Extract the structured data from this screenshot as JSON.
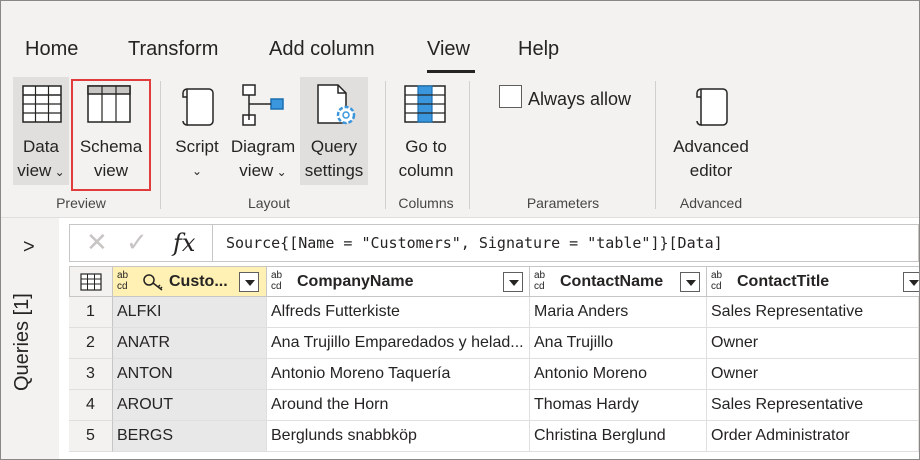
{
  "menu": {
    "tabs": [
      "Home",
      "Transform",
      "Add column",
      "View",
      "Help"
    ],
    "active_tab": "View"
  },
  "ribbon": {
    "preview": {
      "label": "Preview",
      "data_view": [
        "Data",
        "view"
      ],
      "schema_view": [
        "Schema",
        "view"
      ]
    },
    "layout": {
      "label": "Layout",
      "script": "Script",
      "diagram_view": [
        "Diagram",
        "view"
      ],
      "query_settings": [
        "Query",
        "settings"
      ]
    },
    "columns": {
      "label": "Columns",
      "go_to_column": [
        "Go to",
        "column"
      ]
    },
    "parameters": {
      "label": "Parameters",
      "always_allow": "Always allow"
    },
    "advanced": {
      "label": "Advanced",
      "advanced_editor": [
        "Advanced",
        "editor"
      ]
    }
  },
  "queries_pane": {
    "label": "Queries [1]"
  },
  "formula_bar": {
    "fx": "fx",
    "formula": "Source{[Name = \"Customers\", Signature = \"table\"]}[Data]"
  },
  "table": {
    "type_badge": [
      "ab",
      "cd"
    ],
    "columns": [
      "Custo...",
      "CompanyName",
      "ContactName",
      "ContactTitle"
    ],
    "rows": [
      [
        "1",
        "ALFKI",
        "Alfreds Futterkiste",
        "Maria Anders",
        "Sales Representative"
      ],
      [
        "2",
        "ANATR",
        "Ana Trujillo Emparedados y helad...",
        "Ana Trujillo",
        "Owner"
      ],
      [
        "3",
        "ANTON",
        "Antonio Moreno Taquería",
        "Antonio Moreno",
        "Owner"
      ],
      [
        "4",
        "AROUT",
        "Around the Horn",
        "Thomas Hardy",
        "Sales Representative"
      ],
      [
        "5",
        "BERGS",
        "Berglunds snabbköp",
        "Christina Berglund",
        "Order Administrator"
      ]
    ]
  },
  "colors": {
    "accent": "#3a96dd",
    "highlight_border": "#e03c3c",
    "key_header": "#fff0b3"
  }
}
